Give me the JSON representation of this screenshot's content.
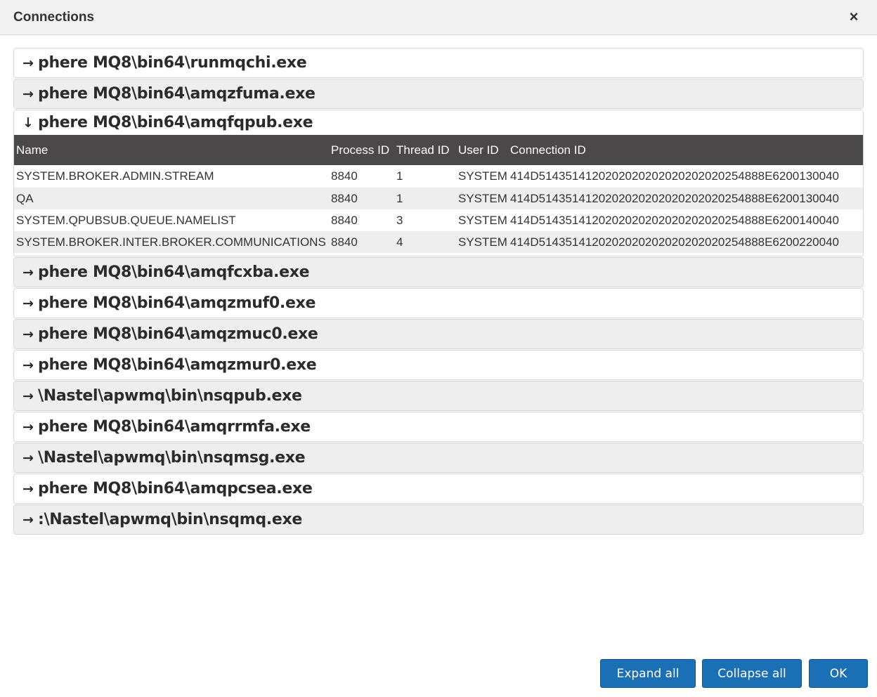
{
  "window": {
    "title": "Connections",
    "close_icon": "×"
  },
  "panels": [
    {
      "title": "phere MQ8\\bin64\\runmqchi.exe",
      "expanded": false
    },
    {
      "title": "phere MQ8\\bin64\\amqzfuma.exe",
      "expanded": false
    },
    {
      "title": "phere MQ8\\bin64\\amqfqpub.exe",
      "expanded": true,
      "columns": [
        "Name",
        "Process ID",
        "Thread ID",
        "User ID",
        "Connection ID"
      ],
      "rows": [
        [
          "SYSTEM.BROKER.ADMIN.STREAM",
          "8840",
          "1",
          "SYSTEM",
          "414D5143514120202020202020202020254888E6200130040"
        ],
        [
          "QA",
          "8840",
          "1",
          "SYSTEM",
          "414D5143514120202020202020202020254888E6200130040"
        ],
        [
          "SYSTEM.QPUBSUB.QUEUE.NAMELIST",
          "8840",
          "3",
          "SYSTEM",
          "414D5143514120202020202020202020254888E6200140040"
        ],
        [
          "SYSTEM.BROKER.INTER.BROKER.COMMUNICATIONS",
          "8840",
          "4",
          "SYSTEM",
          "414D5143514120202020202020202020254888E6200220040"
        ]
      ]
    },
    {
      "title": "phere MQ8\\bin64\\amqfcxba.exe",
      "expanded": false
    },
    {
      "title": "phere MQ8\\bin64\\amqzmuf0.exe",
      "expanded": false
    },
    {
      "title": "phere MQ8\\bin64\\amqzmuc0.exe",
      "expanded": false
    },
    {
      "title": "phere MQ8\\bin64\\amqzmur0.exe",
      "expanded": false
    },
    {
      "title": "\\Nastel\\apwmq\\bin\\nsqpub.exe",
      "expanded": false
    },
    {
      "title": "phere MQ8\\bin64\\amqrrmfa.exe",
      "expanded": false
    },
    {
      "title": "\\Nastel\\apwmq\\bin\\nsqmsg.exe",
      "expanded": false
    },
    {
      "title": "phere MQ8\\bin64\\amqpcsea.exe",
      "expanded": false
    },
    {
      "title": ":\\Nastel\\apwmq\\bin\\nsqmq.exe",
      "expanded": false
    }
  ],
  "icons": {
    "collapsed": "arrow-right-icon",
    "expanded": "arrow-down-icon"
  },
  "footer": {
    "expand_all": "Expand all",
    "collapse_all": "Collapse all",
    "ok": "OK"
  }
}
